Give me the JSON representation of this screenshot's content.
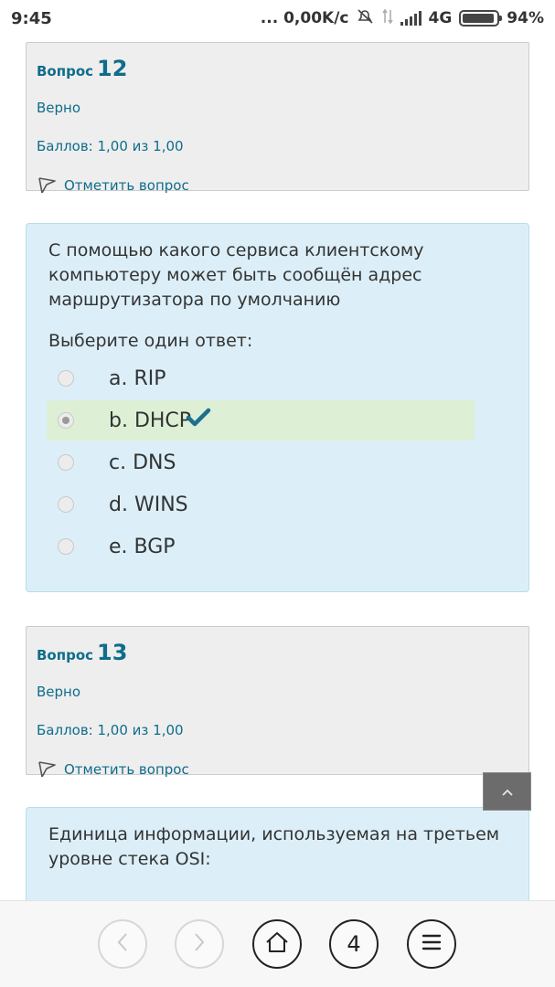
{
  "status_bar": {
    "time": "9:45",
    "net_speed": "... 0,00K/c",
    "network": "4G",
    "battery": "94%"
  },
  "question12": {
    "label": "Вопрос",
    "number": "12",
    "state": "Верно",
    "grade": "Баллов: 1,00 из 1,00",
    "flag_label": "Отметить вопрос"
  },
  "formulation12": {
    "text": "С помощью какого сервиса клиентскому компьютеру может быть сообщён адрес маршрутизатора по умолчанию",
    "prompt": "Выберите один ответ:",
    "answers": [
      {
        "label": "a. RIP",
        "checked": false,
        "correct": false
      },
      {
        "label": "b. DHCP",
        "checked": true,
        "correct": true
      },
      {
        "label": "c. DNS",
        "checked": false,
        "correct": false
      },
      {
        "label": "d. WINS",
        "checked": false,
        "correct": false
      },
      {
        "label": "e. BGP",
        "checked": false,
        "correct": false
      }
    ]
  },
  "question13": {
    "label": "Вопрос",
    "number": "13",
    "state": "Верно",
    "grade": "Баллов: 1,00 из 1,00",
    "flag_label": "Отметить вопрос"
  },
  "formulation13": {
    "text": "Единица информации, используемая на третьем уровне стека OSI:"
  },
  "navbar": {
    "tab_count": "4",
    "icons": [
      "back-icon",
      "forward-icon",
      "home-icon",
      "tabs-icon",
      "menu-icon"
    ]
  },
  "colors": {
    "link": "#0f6d8c",
    "info_bg": "#eeeeee",
    "formulation_bg": "#dceff8",
    "correct_bg": "#ddf0d5",
    "check": "#1f6f8f"
  }
}
